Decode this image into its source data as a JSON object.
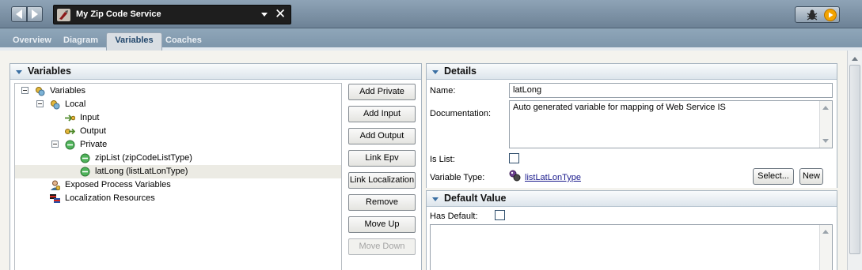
{
  "window": {
    "title": "My Zip Code Service"
  },
  "tabs": [
    {
      "label": "Overview"
    },
    {
      "label": "Diagram"
    },
    {
      "label": "Variables",
      "active": true
    },
    {
      "label": "Coaches"
    }
  ],
  "variables_panel": {
    "title": "Variables",
    "tree": [
      {
        "label": "Variables",
        "icon": "variables-icon"
      },
      {
        "label": "Local",
        "icon": "variables-icon"
      },
      {
        "label": "Input",
        "icon": "input-arrow-icon"
      },
      {
        "label": "Output",
        "icon": "output-arrow-icon"
      },
      {
        "label": "Private",
        "icon": "private-circle-icon"
      },
      {
        "label": "zipList (zipCodeListType)",
        "icon": "variable-circle-icon"
      },
      {
        "label": "latLong (listLatLonType)",
        "icon": "variable-circle-icon",
        "selected": true
      },
      {
        "label": "Exposed Process Variables",
        "icon": "exposed-variables-icon"
      },
      {
        "label": "Localization Resources",
        "icon": "localization-icon"
      }
    ],
    "buttons": {
      "add_private": "Add Private",
      "add_input": "Add Input",
      "add_output": "Add Output",
      "link_epv": "Link Epv",
      "link_localization": "Link Localization",
      "remove": "Remove",
      "move_up": "Move Up",
      "move_down": "Move Down"
    }
  },
  "details_panel": {
    "title": "Details",
    "name_label": "Name:",
    "name_value": "latLong",
    "documentation_label": "Documentation:",
    "documentation_value": "Auto generated variable for mapping of Web Service IS",
    "is_list_label": "Is List:",
    "is_list_checked": false,
    "variable_type_label": "Variable Type:",
    "variable_type_value": "listLatLonType",
    "select_button": "Select...",
    "new_button": "New"
  },
  "default_value_panel": {
    "title": "Default Value",
    "has_default_label": "Has Default:",
    "has_default_checked": false
  },
  "colors": {
    "topbar": "#7b90a3",
    "active_tab_text": "#21466b",
    "link": "#1a1a8c",
    "selection": "#ecebe4"
  }
}
